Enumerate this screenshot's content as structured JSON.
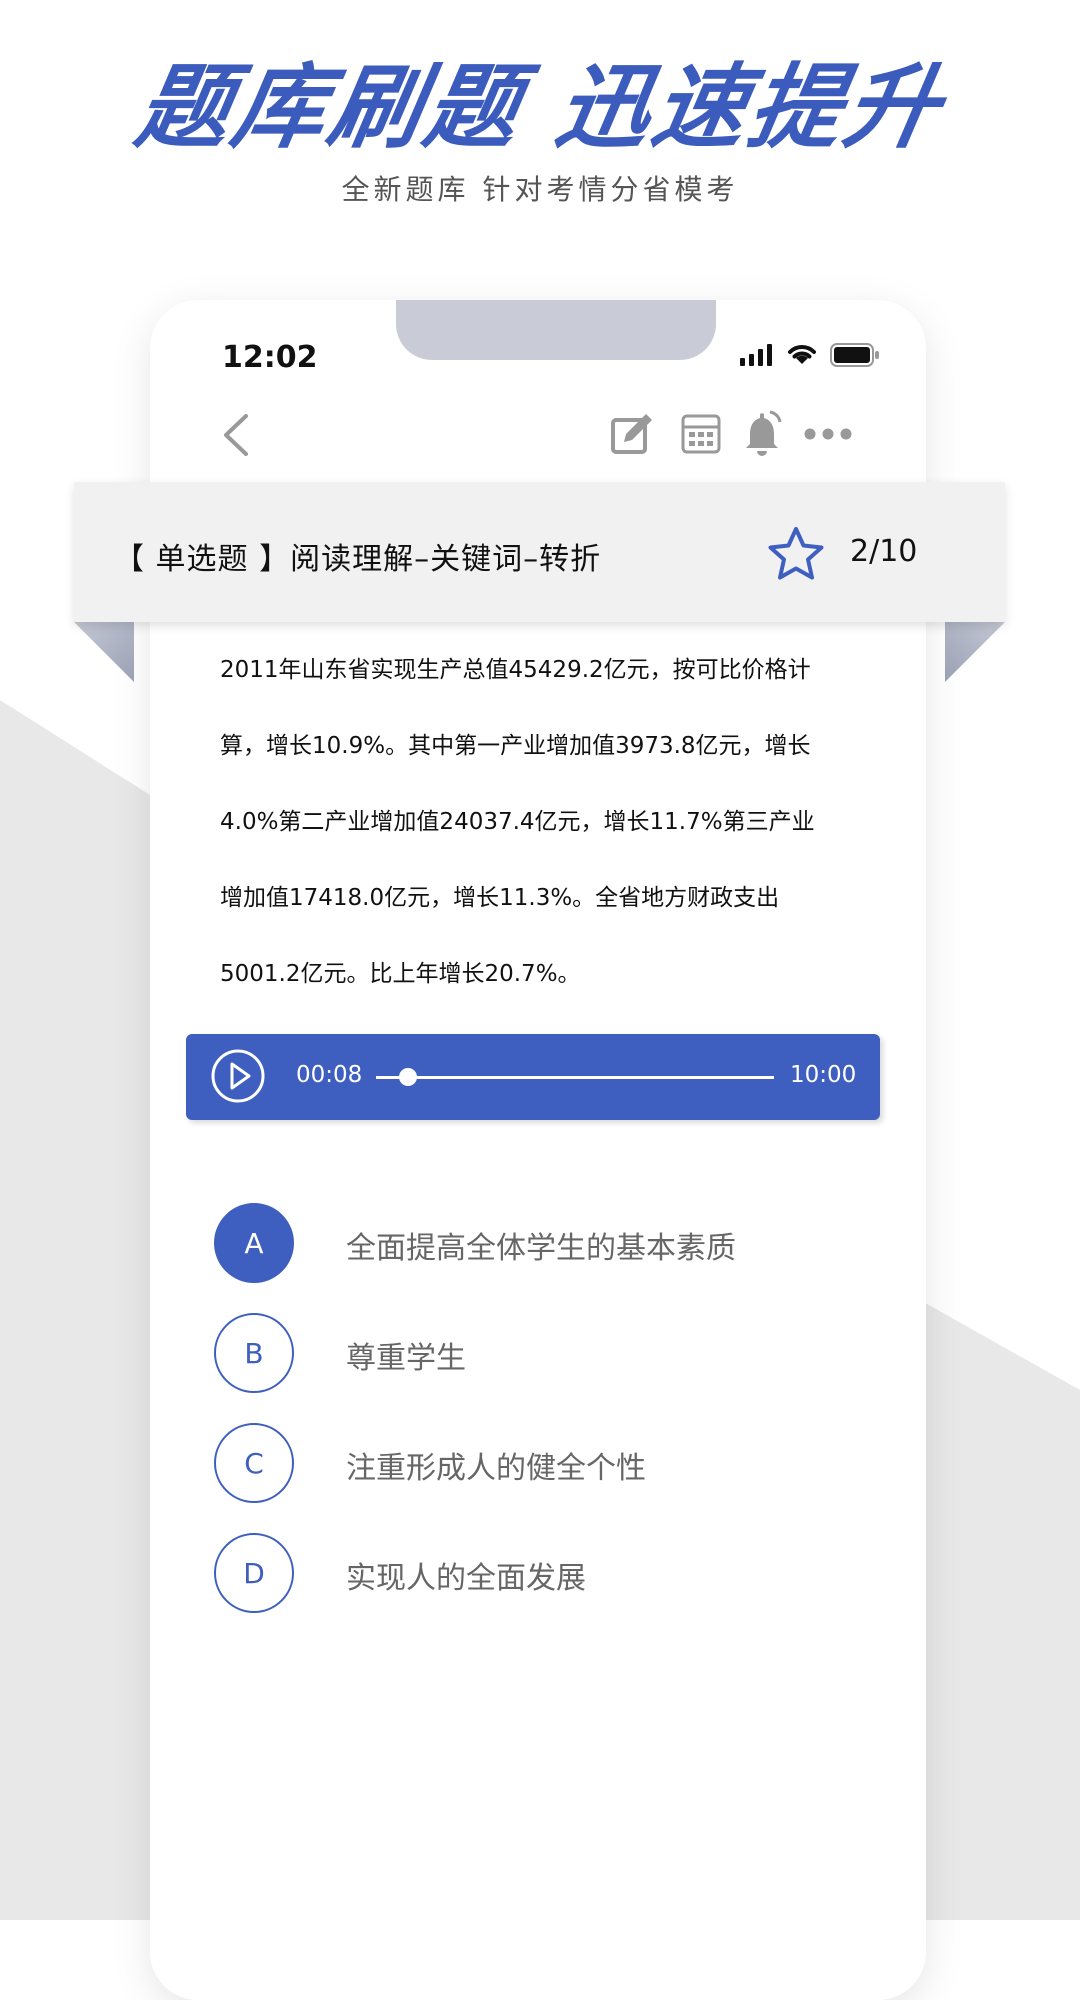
{
  "hero": {
    "title": "题库刷题 迅速提升",
    "subtitle": "全新题库  针对考情分省模考"
  },
  "status_bar": {
    "time": "12:02"
  },
  "toolbar": {
    "icons": [
      "chevron-left-icon",
      "edit-icon",
      "grid-icon",
      "bell-icon",
      "more-icon"
    ]
  },
  "question": {
    "type_label": "【 单选题 】阅读理解–关键词–转折",
    "progress": "2/10",
    "passage_lines": [
      "2011年山东省实现生产总值45429.2亿元，按可比价格计",
      "算，增长10.9%。其中第一产业增加值3973.8亿元，增长",
      "4.0%第二产业增加值24037.4亿元，增长11.7%第三产业",
      "增加值17418.0亿元，增长11.3%。全省地方财政支出",
      "5001.2亿元。比上年增长20.7%。"
    ]
  },
  "audio": {
    "current": "00:08",
    "total": "10:00",
    "progress_fraction": 0.08
  },
  "options": [
    {
      "letter": "A",
      "text": "全面提高全体学生的基本素质",
      "selected": true
    },
    {
      "letter": "B",
      "text": "尊重学生",
      "selected": false
    },
    {
      "letter": "C",
      "text": "注重形成人的健全个性",
      "selected": false
    },
    {
      "letter": "D",
      "text": "实现人的全面发展",
      "selected": false
    }
  ],
  "colors": {
    "accent": "#3e5fc0",
    "hero_title": "#3b5bbd",
    "ribbon_bg": "#f1f1f2",
    "option_text": "#666666"
  }
}
